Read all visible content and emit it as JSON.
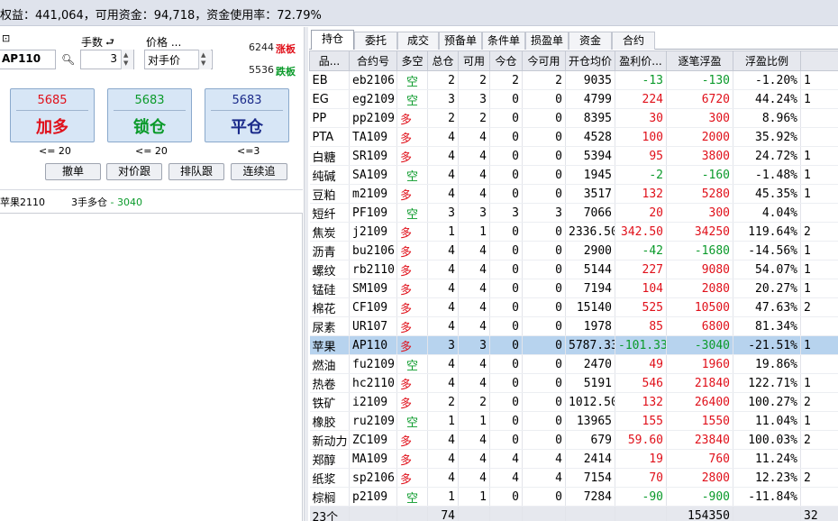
{
  "top_status": "权益：441,064，可用资金：94,718，资金使用率：72.79%",
  "order_panel": {
    "contract_label": "",
    "contract_value": "AP110",
    "lots_label": "手数",
    "lots_value": "3",
    "price_label": "价格 ...",
    "price_value": "对手价",
    "limit_up_value": "6244",
    "limit_up_label": "涨板",
    "limit_down_value": "5536",
    "limit_down_label": "跌板",
    "buttons": [
      {
        "price": "5685",
        "action": "加多",
        "limit": "<= 20"
      },
      {
        "price": "5683",
        "action": "锁仓",
        "limit": "<= 20"
      },
      {
        "price": "5683",
        "action": "平仓",
        "limit": "<=3"
      }
    ],
    "small_buttons": [
      "撤单",
      "对价跟",
      "排队跟",
      "连续追"
    ],
    "position_info": {
      "name": "苹果2110",
      "desc": "3手多仓",
      "pnl": "- 3040"
    }
  },
  "tabs": [
    "持仓",
    "委托",
    "成交",
    "预备单",
    "条件单",
    "损盈单",
    "资金",
    "合约"
  ],
  "table": {
    "headers": [
      "品...",
      "合约号",
      "多空",
      "总仓",
      "可用",
      "今仓",
      "今可用",
      "开仓均价",
      "盈利价...",
      "逐笔浮盈",
      "浮盈比例",
      ""
    ],
    "rows": [
      [
        "EB",
        "eb2106",
        "空",
        "2",
        "2",
        "2",
        "2",
        "9035",
        "-13",
        "-130",
        "-1.20%",
        "1"
      ],
      [
        "EG",
        "eg2109",
        "空",
        "3",
        "3",
        "0",
        "0",
        "4799",
        "224",
        "6720",
        "44.24%",
        "1"
      ],
      [
        "PP",
        "pp2109",
        "多",
        "2",
        "2",
        "0",
        "0",
        "8395",
        "30",
        "300",
        "8.96%",
        ""
      ],
      [
        "PTA",
        "TA109",
        "多",
        "4",
        "4",
        "0",
        "0",
        "4528",
        "100",
        "2000",
        "35.92%",
        ""
      ],
      [
        "白糖",
        "SR109",
        "多",
        "4",
        "4",
        "0",
        "0",
        "5394",
        "95",
        "3800",
        "24.72%",
        "1"
      ],
      [
        "纯碱",
        "SA109",
        "空",
        "4",
        "4",
        "0",
        "0",
        "1945",
        "-2",
        "-160",
        "-1.48%",
        "1"
      ],
      [
        "豆粕",
        "m2109",
        "多",
        "4",
        "4",
        "0",
        "0",
        "3517",
        "132",
        "5280",
        "45.35%",
        "1"
      ],
      [
        "短纤",
        "PF109",
        "空",
        "3",
        "3",
        "3",
        "3",
        "7066",
        "20",
        "300",
        "4.04%",
        ""
      ],
      [
        "焦炭",
        "j2109",
        "多",
        "1",
        "1",
        "0",
        "0",
        "2336.50",
        "342.50",
        "34250",
        "119.64%",
        "2"
      ],
      [
        "沥青",
        "bu2106",
        "多",
        "4",
        "4",
        "0",
        "0",
        "2900",
        "-42",
        "-1680",
        "-14.56%",
        "1"
      ],
      [
        "螺纹",
        "rb2110",
        "多",
        "4",
        "4",
        "0",
        "0",
        "5144",
        "227",
        "9080",
        "54.07%",
        "1"
      ],
      [
        "锰硅",
        "SM109",
        "多",
        "4",
        "4",
        "0",
        "0",
        "7194",
        "104",
        "2080",
        "20.27%",
        "1"
      ],
      [
        "棉花",
        "CF109",
        "多",
        "4",
        "4",
        "0",
        "0",
        "15140",
        "525",
        "10500",
        "47.63%",
        "2"
      ],
      [
        "尿素",
        "UR107",
        "多",
        "4",
        "4",
        "0",
        "0",
        "1978",
        "85",
        "6800",
        "81.34%",
        ""
      ],
      [
        "苹果",
        "AP110",
        "多",
        "3",
        "3",
        "0",
        "0",
        "5787.33",
        "-101.33",
        "-3040",
        "-21.51%",
        "1"
      ],
      [
        "燃油",
        "fu2109",
        "空",
        "4",
        "4",
        "0",
        "0",
        "2470",
        "49",
        "1960",
        "19.86%",
        ""
      ],
      [
        "热卷",
        "hc2110",
        "多",
        "4",
        "4",
        "0",
        "0",
        "5191",
        "546",
        "21840",
        "122.71%",
        "1"
      ],
      [
        "铁矿",
        "i2109",
        "多",
        "2",
        "2",
        "0",
        "0",
        "1012.50",
        "132",
        "26400",
        "100.27%",
        "2"
      ],
      [
        "橡胶",
        "ru2109",
        "空",
        "1",
        "1",
        "0",
        "0",
        "13965",
        "155",
        "1550",
        "11.04%",
        "1"
      ],
      [
        "新动力",
        "ZC109",
        "多",
        "4",
        "4",
        "0",
        "0",
        "679",
        "59.60",
        "23840",
        "100.03%",
        "2"
      ],
      [
        "郑醇",
        "MA109",
        "多",
        "4",
        "4",
        "4",
        "4",
        "2414",
        "19",
        "760",
        "11.24%",
        ""
      ],
      [
        "纸浆",
        "sp2106",
        "多",
        "4",
        "4",
        "4",
        "4",
        "7154",
        "70",
        "2800",
        "12.23%",
        "2"
      ],
      [
        "棕榈",
        "p2109",
        "空",
        "1",
        "1",
        "0",
        "0",
        "7284",
        "-90",
        "-900",
        "-11.84%",
        ""
      ]
    ],
    "footer": [
      "23个",
      "",
      "",
      "74",
      "",
      "",
      "",
      "",
      "",
      "154350",
      "",
      "32"
    ],
    "selected_row": 14
  },
  "colors": {
    "up": "#e0101a",
    "down": "#0a9a2a",
    "selected": "#b7d3ee"
  }
}
